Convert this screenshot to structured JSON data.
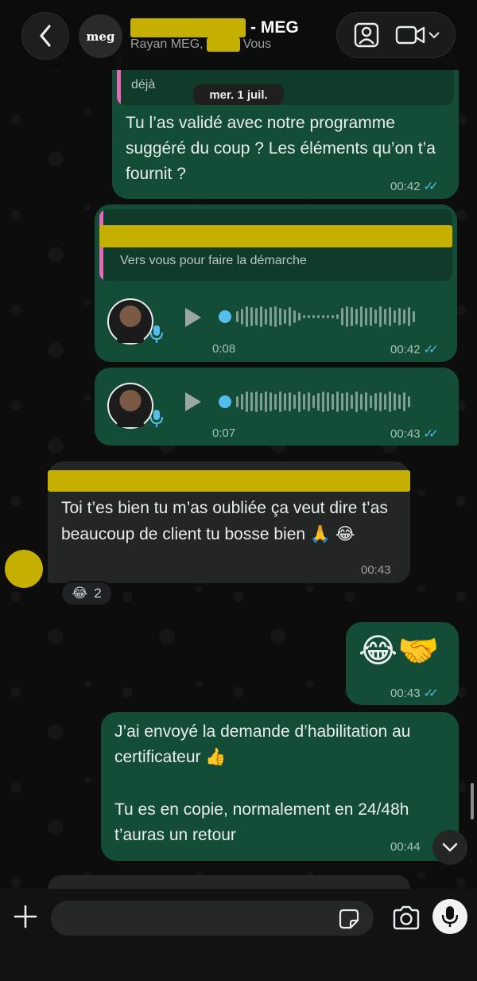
{
  "header": {
    "title_suffix": "- MEG",
    "group_avatar_text": "meg",
    "subtitle_prefix": "Rayan MEG,",
    "subtitle_suffix": "Vous"
  },
  "date_divider": "mer. 1 juil.",
  "messages": [
    {
      "quoted_tail": "déjà",
      "text": "Tu l’as validé avec notre programme suggéré du coup ? Les éléments qu’on t’a fournit ?",
      "time": "00:42",
      "ticks": "✓✓"
    },
    {
      "quoted_text": "Vers vous pour faire la démarche",
      "voice_duration": "0:08",
      "time": "00:42",
      "ticks": "✓✓"
    },
    {
      "voice_duration": "0:07",
      "time": "00:43",
      "ticks": "✓✓"
    },
    {
      "text": "Toi t’es bien tu m’as oubliée ça veut dire t’as beaucoup de client tu bosse bien 🙏 😂",
      "time": "00:43",
      "reaction_emoji": "😂",
      "reaction_count": "2"
    },
    {
      "text": "😂🤝",
      "time": "00:43",
      "ticks": "✓✓"
    },
    {
      "text_line1": "J’ai envoyé la demande d’habilitation au certificateur 👍",
      "text_line2": "Tu es en copie, normalement en 24/48h t’auras un retour",
      "time": "00:44"
    }
  ],
  "composer": {
    "placeholder": ""
  },
  "colors": {
    "outgoing_bubble": "#144d37",
    "incoming_bubble": "#242626",
    "redaction": "#c5af00",
    "read_ticks": "#53bdeb"
  },
  "icons": [
    "back-chevron-icon",
    "add-participant-icon",
    "video-call-icon",
    "chevron-down-icon",
    "play-icon",
    "microphone-icon",
    "plus-icon",
    "sticker-icon",
    "camera-icon"
  ]
}
